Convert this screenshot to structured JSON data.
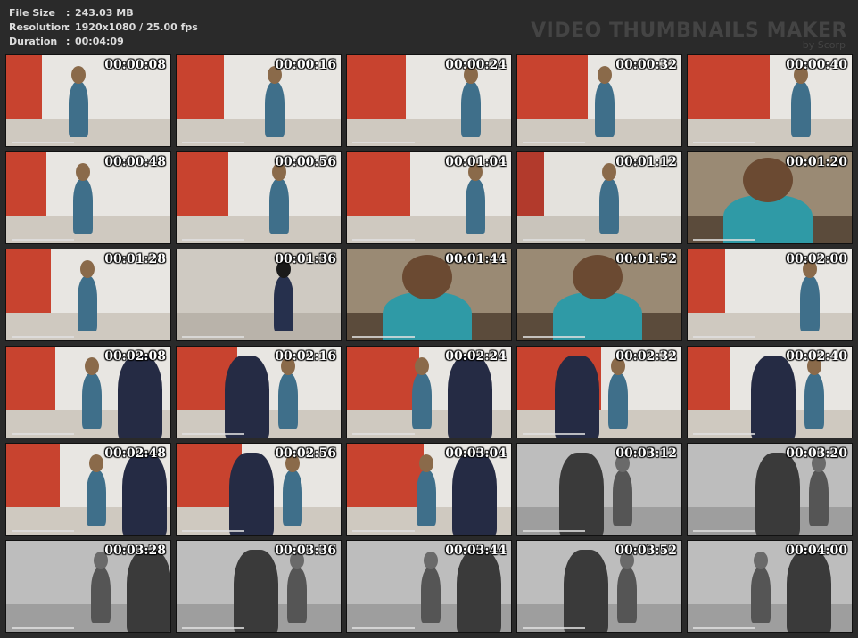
{
  "info": {
    "file_size_label": "File Size",
    "file_size_value": "243.03 MB",
    "resolution_label": "Resolution",
    "resolution_value": "1920x1080 / 25.00 fps",
    "duration_label": "Duration",
    "duration_value": "00:04:09",
    "separator": ":"
  },
  "brand": {
    "title": "VIDEO THUMBNAILS MAKER",
    "subtitle": "by Scorp"
  },
  "thumbnails": [
    {
      "time": "00:00:08",
      "scene": "red"
    },
    {
      "time": "00:00:16",
      "scene": "red"
    },
    {
      "time": "00:00:24",
      "scene": "red"
    },
    {
      "time": "00:00:32",
      "scene": "red"
    },
    {
      "time": "00:00:40",
      "scene": "red"
    },
    {
      "time": "00:00:48",
      "scene": "red"
    },
    {
      "time": "00:00:56",
      "scene": "red"
    },
    {
      "time": "00:01:04",
      "scene": "red"
    },
    {
      "time": "00:01:12",
      "scene": "white"
    },
    {
      "time": "00:01:20",
      "scene": "closeup"
    },
    {
      "time": "00:01:28",
      "scene": "red"
    },
    {
      "time": "00:01:36",
      "scene": "floor"
    },
    {
      "time": "00:01:44",
      "scene": "closeup"
    },
    {
      "time": "00:01:52",
      "scene": "closeup"
    },
    {
      "time": "00:02:00",
      "scene": "red"
    },
    {
      "time": "00:02:08",
      "scene": "red"
    },
    {
      "time": "00:02:16",
      "scene": "red"
    },
    {
      "time": "00:02:24",
      "scene": "red"
    },
    {
      "time": "00:02:32",
      "scene": "red"
    },
    {
      "time": "00:02:40",
      "scene": "red"
    },
    {
      "time": "00:02:48",
      "scene": "red"
    },
    {
      "time": "00:02:56",
      "scene": "red"
    },
    {
      "time": "00:03:04",
      "scene": "red"
    },
    {
      "time": "00:03:12",
      "scene": "gray"
    },
    {
      "time": "00:03:20",
      "scene": "gray"
    },
    {
      "time": "00:03:28",
      "scene": "gray"
    },
    {
      "time": "00:03:36",
      "scene": "gray"
    },
    {
      "time": "00:03:44",
      "scene": "gray"
    },
    {
      "time": "00:03:52",
      "scene": "gray"
    },
    {
      "time": "00:04:00",
      "scene": "gray"
    }
  ],
  "colors": {
    "background": "#2a2a2a",
    "info_text": "#dcdcdc",
    "brand_text": "#444444",
    "timestamp": "#ffffff"
  }
}
